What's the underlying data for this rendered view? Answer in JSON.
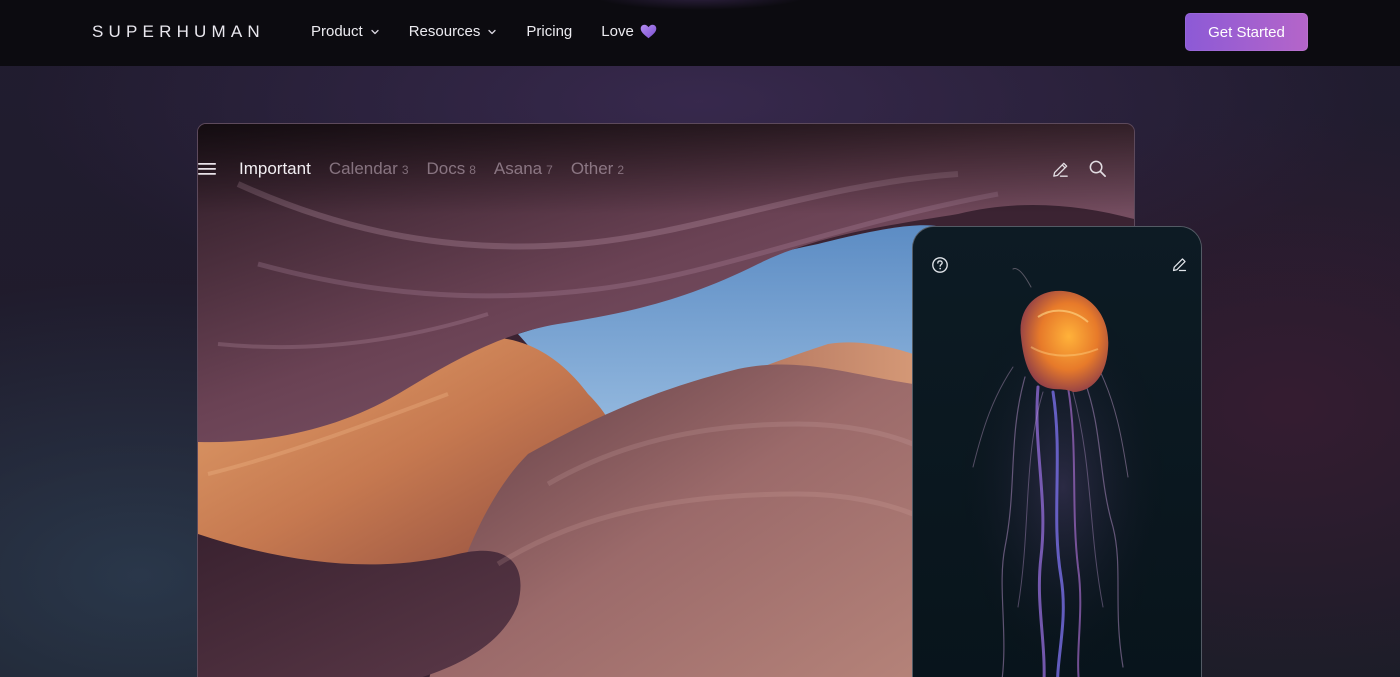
{
  "nav": {
    "logo": "SUPERHUMAN",
    "links": [
      {
        "label": "Product",
        "dropdown": true
      },
      {
        "label": "Resources",
        "dropdown": true
      },
      {
        "label": "Pricing",
        "dropdown": false
      },
      {
        "label": "Love",
        "dropdown": false,
        "icon": "purple-heart-icon"
      }
    ],
    "cta_label": "Get Started"
  },
  "desktop_app": {
    "split_tabs": [
      {
        "label": "Important",
        "count": "",
        "active": true
      },
      {
        "label": "Calendar",
        "count": "3",
        "active": false
      },
      {
        "label": "Docs",
        "count": "8",
        "active": false
      },
      {
        "label": "Asana",
        "count": "7",
        "active": false
      },
      {
        "label": "Other",
        "count": "2",
        "active": false
      }
    ],
    "icons": [
      "menu-icon",
      "compose-icon",
      "search-icon"
    ],
    "background_image": "antelope-canyon-photo"
  },
  "phone_app": {
    "icons": [
      "help-icon",
      "compose-icon"
    ],
    "background_image": "jellyfish-photo"
  },
  "colors": {
    "nav_background": "#0c0b10",
    "cta_gradient_start": "#8c5ad6",
    "cta_gradient_end": "#b565c9",
    "heart": "#9b6ee0",
    "page_background": "#1f1b2b"
  }
}
